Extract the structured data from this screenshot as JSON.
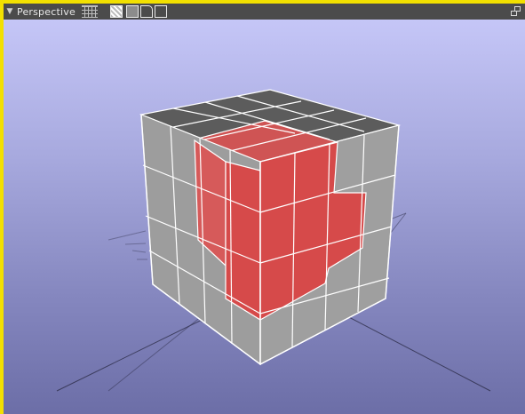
{
  "panel": {
    "title": "Perspective",
    "collapse_glyph": "▼"
  },
  "toolbar": {
    "icons": [
      "grid-icon",
      "shaded-wireframe-icon",
      "shaded-icon",
      "wireframe-icon",
      "wireframe-alt-icon"
    ]
  },
  "window_controls": {
    "restore": "restore-icon"
  },
  "scene": {
    "object": "cube",
    "subdivisions": 4,
    "face_color_base": "#a3a3a3",
    "face_color_highlight": "#d64a4a",
    "edge_color": "#ffffff",
    "grid_color": "#1a1a2e",
    "background_top": "#c5c6f7",
    "background_bottom": "#6c6ea7"
  }
}
